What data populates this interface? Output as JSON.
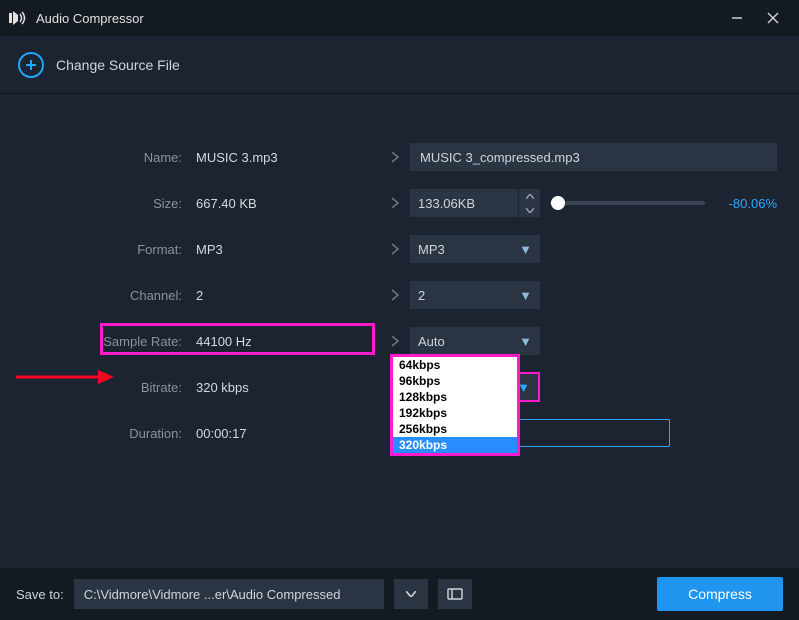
{
  "titlebar": {
    "title": "Audio Compressor"
  },
  "source": {
    "change_label": "Change Source File"
  },
  "form": {
    "name": {
      "label": "Name:",
      "original": "MUSIC 3.mp3",
      "output": "MUSIC 3_compressed.mp3"
    },
    "size": {
      "label": "Size:",
      "original": "667.40 KB",
      "output": "133.06KB",
      "percent": "-80.06%"
    },
    "format": {
      "label": "Format:",
      "original": "MP3",
      "selected": "MP3"
    },
    "channel": {
      "label": "Channel:",
      "original": "2",
      "selected": "2"
    },
    "sample_rate": {
      "label": "Sample Rate:",
      "original": "44100 Hz",
      "selected": "Auto"
    },
    "bitrate": {
      "label": "Bitrate:",
      "original": "320 kbps",
      "selected": "320kbps",
      "options": [
        "64kbps",
        "96kbps",
        "128kbps",
        "192kbps",
        "256kbps",
        "320kbps"
      ]
    },
    "duration": {
      "label": "Duration:",
      "value": "00:00:17"
    }
  },
  "bottom": {
    "save_label": "Save to:",
    "path": "C:\\Vidmore\\Vidmore ...er\\Audio Compressed",
    "compress": "Compress"
  }
}
